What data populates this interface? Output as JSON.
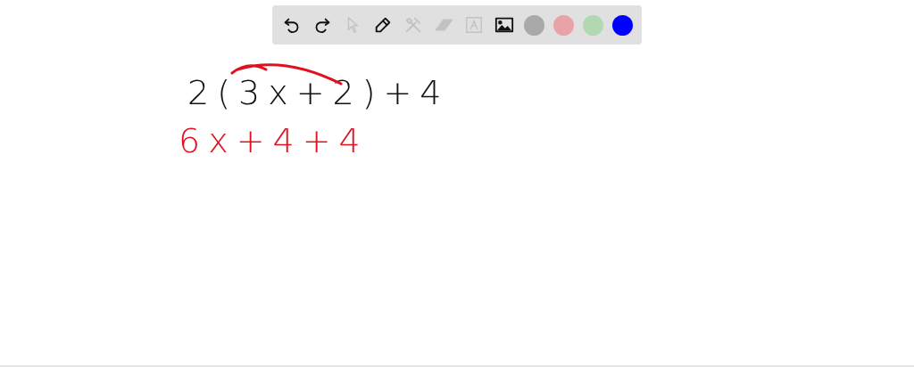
{
  "toolbar": {
    "tools": [
      {
        "kind": "undo",
        "disabled": false
      },
      {
        "kind": "redo",
        "disabled": false
      },
      {
        "kind": "select",
        "disabled": true
      },
      {
        "kind": "pen",
        "disabled": false
      },
      {
        "kind": "tools",
        "disabled": true
      },
      {
        "kind": "eraser",
        "disabled": true
      },
      {
        "kind": "text",
        "disabled": true
      },
      {
        "kind": "image",
        "disabled": false
      }
    ],
    "colors": [
      {
        "color": "#a9a9a9"
      },
      {
        "color": "#e8a3a8"
      },
      {
        "color": "#b2d8b2"
      },
      {
        "color": "#0000ff"
      }
    ]
  },
  "canvas": {
    "lines": [
      {
        "text": "2(3x+2)+4",
        "color": "#111111",
        "arc": true
      },
      {
        "text": "6x+4+4",
        "color": "#e0101e",
        "arc": false
      }
    ]
  }
}
